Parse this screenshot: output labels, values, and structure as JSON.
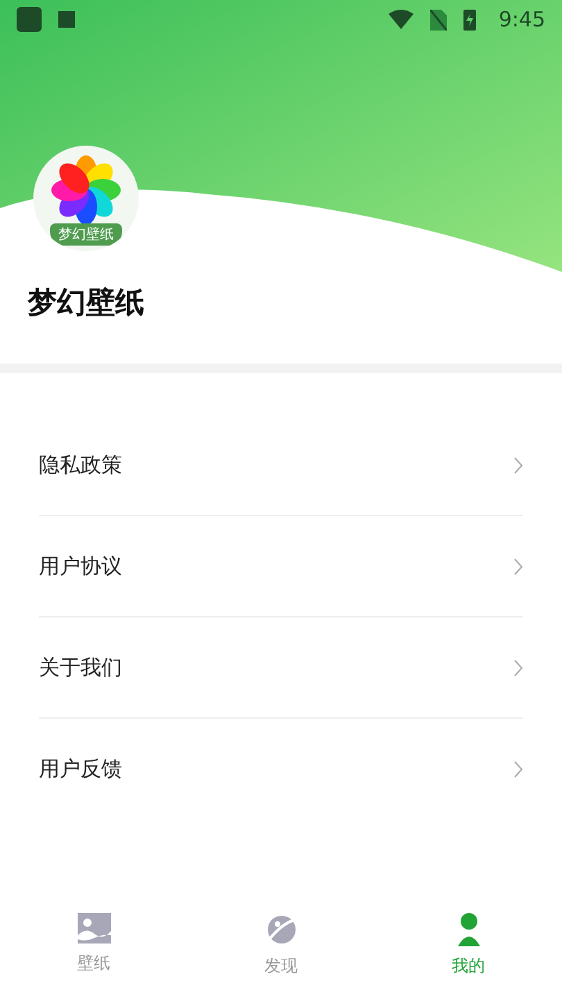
{
  "status_bar": {
    "time": "9:45"
  },
  "app": {
    "logo_text": "梦幻壁纸",
    "name": "梦幻壁纸"
  },
  "menu": [
    {
      "label": "隐私政策"
    },
    {
      "label": "用户协议"
    },
    {
      "label": "关于我们"
    },
    {
      "label": "用户反馈"
    }
  ],
  "tabs": [
    {
      "label": "壁纸",
      "kind": "wallpaper",
      "selected": false
    },
    {
      "label": "发现",
      "kind": "discover",
      "selected": false
    },
    {
      "label": "我的",
      "kind": "profile",
      "selected": true
    }
  ]
}
